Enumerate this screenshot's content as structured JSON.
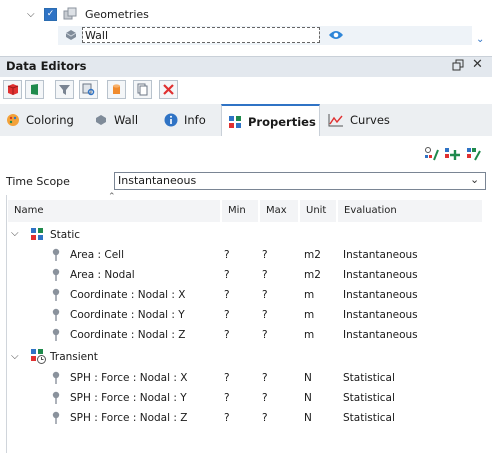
{
  "tree": {
    "geometries_label": "Geometries",
    "wall_label": "Wall"
  },
  "panel": {
    "title": "Data Editors"
  },
  "tabs": [
    {
      "label": "Coloring"
    },
    {
      "label": "Wall"
    },
    {
      "label": "Info"
    },
    {
      "label": "Properties"
    },
    {
      "label": "Curves"
    }
  ],
  "time_scope": {
    "label": "Time Scope",
    "value": "Instantaneous"
  },
  "columns": {
    "name": "Name",
    "min": "Min",
    "max": "Max",
    "unit": "Unit",
    "evaluation": "Evaluation"
  },
  "groups": {
    "static": {
      "label": "Static",
      "rows": [
        {
          "name": "Area : Cell",
          "min": "?",
          "max": "?",
          "unit": "m2",
          "evaluation": "Instantaneous"
        },
        {
          "name": "Area : Nodal",
          "min": "?",
          "max": "?",
          "unit": "m2",
          "evaluation": "Instantaneous"
        },
        {
          "name": "Coordinate : Nodal : X",
          "min": "?",
          "max": "?",
          "unit": "m",
          "evaluation": "Instantaneous"
        },
        {
          "name": "Coordinate : Nodal : Y",
          "min": "?",
          "max": "?",
          "unit": "m",
          "evaluation": "Instantaneous"
        },
        {
          "name": "Coordinate : Nodal : Z",
          "min": "?",
          "max": "?",
          "unit": "m",
          "evaluation": "Instantaneous"
        }
      ]
    },
    "transient": {
      "label": "Transient",
      "rows": [
        {
          "name": "SPH : Force : Nodal : X",
          "min": "?",
          "max": "?",
          "unit": "N",
          "evaluation": "Statistical"
        },
        {
          "name": "SPH : Force : Nodal : Y",
          "min": "?",
          "max": "?",
          "unit": "N",
          "evaluation": "Statistical"
        },
        {
          "name": "SPH : Force : Nodal : Z",
          "min": "?",
          "max": "?",
          "unit": "N",
          "evaluation": "Statistical"
        }
      ]
    }
  },
  "colors": {
    "accent": "#2f73c5",
    "toolbar_red": "#e03030",
    "toolbar_green": "#1f8a4c"
  }
}
